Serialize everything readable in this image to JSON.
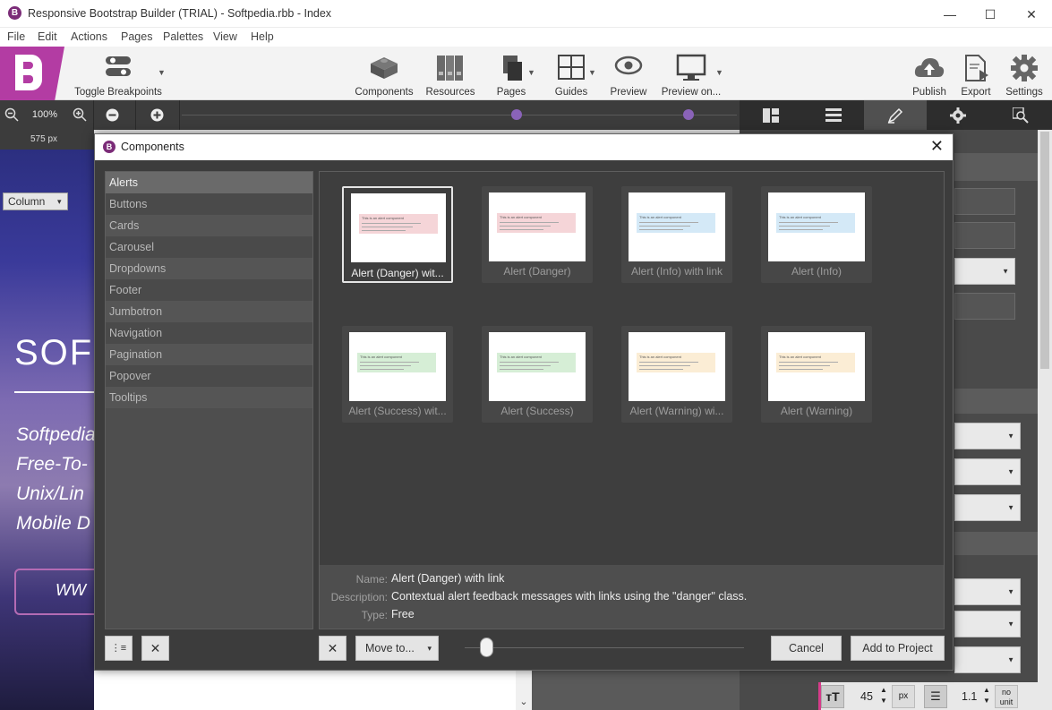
{
  "window": {
    "title": "Responsive Bootstrap Builder (TRIAL) - Softpedia.rbb - Index",
    "app_icon": "B",
    "controls": {
      "minimize": "—",
      "maximize": "☐",
      "close": "✕"
    }
  },
  "menu": [
    "File",
    "Edit",
    "Actions",
    "Pages",
    "Palettes",
    "View",
    "Help"
  ],
  "toolbar": {
    "toggle_breakpoints": "Toggle Breakpoints",
    "components": "Components",
    "resources": "Resources",
    "pages": "Pages",
    "guides": "Guides",
    "preview": "Preview",
    "preview_on": "Preview on...",
    "publish": "Publish",
    "export": "Export",
    "settings": "Settings"
  },
  "zoom": {
    "level": "100%",
    "minus": "−",
    "plus": "+"
  },
  "ruler": {
    "width_label": "575 px"
  },
  "canvas_preview": {
    "column_label": "Column",
    "column_arrow": "▾",
    "heading": "SOFT",
    "lines": [
      "Softpedia",
      "Free-To-",
      "Unix/Lin",
      "Mobile D"
    ],
    "button": "WW",
    "scroll_arrow": "⌄"
  },
  "font_controls": {
    "size": "45",
    "unit": "px",
    "line_height": "1.1",
    "no_unit": "no unit"
  },
  "dialog": {
    "title": "Components",
    "icon": "B",
    "close": "✕",
    "categories": [
      "Alerts",
      "Buttons",
      "Cards",
      "Carousel",
      "Dropdowns",
      "Footer",
      "Jumbotron",
      "Navigation",
      "Pagination",
      "Popover",
      "Tooltips"
    ],
    "selected_category": "Alerts",
    "components": [
      {
        "caption": "Alert (Danger) wit...",
        "alert_text": "This is an alert component",
        "color": "#f5d5d8",
        "selected": true
      },
      {
        "caption": "Alert (Danger)",
        "alert_text": "This is an alert component",
        "color": "#f5d5d8",
        "selected": false
      },
      {
        "caption": "Alert (Info) with link",
        "alert_text": "This is an alert component",
        "color": "#d4e9f7",
        "selected": false
      },
      {
        "caption": "Alert (Info)",
        "alert_text": "This is an alert component",
        "color": "#d4e9f7",
        "selected": false
      },
      {
        "caption": "Alert (Success) wit...",
        "alert_text": "This is an alert component",
        "color": "#d6eed6",
        "selected": false
      },
      {
        "caption": "Alert (Success)",
        "alert_text": "This is an alert component",
        "color": "#d6eed6",
        "selected": false
      },
      {
        "caption": "Alert (Warning) wi...",
        "alert_text": "This is an alert component",
        "color": "#fbedd5",
        "selected": false
      },
      {
        "caption": "Alert (Warning)",
        "alert_text": "This is an alert component",
        "color": "#fbedd5",
        "selected": false
      }
    ],
    "info": {
      "name_label": "Name:",
      "name_value": "Alert (Danger) with link",
      "description_label": "Description:",
      "description_value": "Contextual alert feedback messages with links using the \"danger\" class.",
      "type_label": "Type:",
      "type_value": "Free"
    },
    "buttons": {
      "move_to": "Move to...",
      "move_arrow": "▾",
      "cancel": "Cancel",
      "add_to_project": "Add to Project",
      "add_category_icon": "⋮≡",
      "delete_icon": "✕"
    }
  }
}
